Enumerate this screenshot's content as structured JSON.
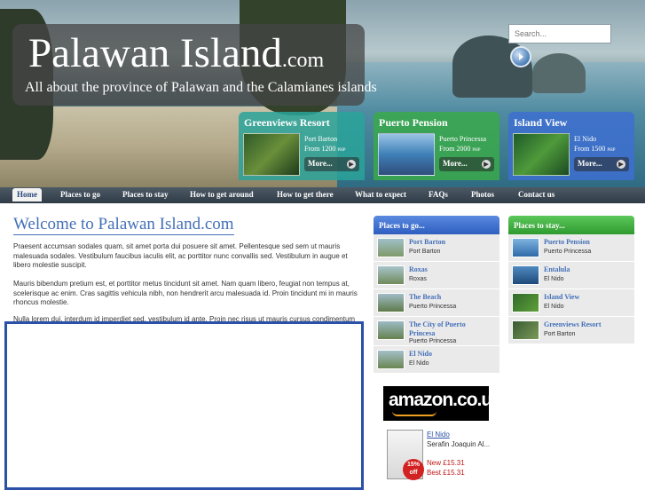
{
  "header": {
    "title": "Palawan Island",
    "title_suffix": ".com",
    "subtitle": "All about the province of Palawan and the Calamianes islands",
    "search": {
      "placeholder": "Search..."
    }
  },
  "features": [
    {
      "title": "Greenviews Resort",
      "location": "Port Barton",
      "price": "From 1200",
      "currency": "PHP",
      "more": "More...",
      "color": "#2aa39a"
    },
    {
      "title": "Puerto Pension",
      "location": "Puerto Princessa",
      "price": "From 2000",
      "currency": "PHP",
      "more": "More...",
      "color": "#3aa94a"
    },
    {
      "title": "Island View",
      "location": "El Nido",
      "price": "From 1500",
      "currency": "PHP",
      "more": "More...",
      "color": "#3d6ed0"
    }
  ],
  "nav": [
    "Home",
    "Places to go",
    "Places to stay",
    "How to get around",
    "How to get there",
    "What to expect",
    "FAQs",
    "Photos",
    "Contact us"
  ],
  "main": {
    "welcome": "Welcome to Palawan Island.com",
    "paragraphs": [
      "Praesent accumsan sodales quam, sit amet porta dui posuere sit amet. Pellentesque sed sem ut mauris malesuada sodales. Vestibulum faucibus iaculis elit, ac porttitor nunc convallis sed. Vestibulum in augue et libero molestie suscipit.",
      "Mauris bibendum pretium est, et porttitor metus tincidunt sit amet. Nam quam libero, feugiat non tempus at, scelerisque ac enim. Cras sagittis vehicula nibh, non hendrerit arcu malesuada id. Proin tincidunt mi in mauris rhoncus molestie.",
      "Nulla lorem dui, interdum id imperdiet sed, vestibulum id ante. Proin nec risus ut mauris cursus condimentum id eget felis. In vitae quam in nisl consectetur tempor eget ut sem."
    ]
  },
  "places_to_go": {
    "heading": "Places to go...",
    "items": [
      {
        "name": "Port Barton",
        "location": "Port Barton"
      },
      {
        "name": "Roxas",
        "location": "Roxas"
      },
      {
        "name": "The Beach",
        "location": "Puerto Princessa"
      },
      {
        "name": "The City of Puerto Princesa",
        "location": "Puerto Princessa"
      },
      {
        "name": "El Nido",
        "location": "El Nido"
      }
    ]
  },
  "places_to_stay": {
    "heading": "Places to stay...",
    "items": [
      {
        "name": "Puerto Pension",
        "location": "Puerto Princessa"
      },
      {
        "name": "Entalula",
        "location": "El Nido"
      },
      {
        "name": "Island View",
        "location": "El Nido"
      },
      {
        "name": "Greenviews Resort",
        "location": "Port Barton"
      }
    ]
  },
  "amazon": {
    "logo": "amazon.co.uk",
    "book_title": "El Nido",
    "author": "Serafin Joaquin Al...",
    "new_price": "New £15.31",
    "best_price": "Best £15.31",
    "badge": "15% off"
  },
  "colors": {
    "go_head": "#3d6ed0",
    "stay_head": "#3aa94a",
    "accent": "#4470b8"
  }
}
